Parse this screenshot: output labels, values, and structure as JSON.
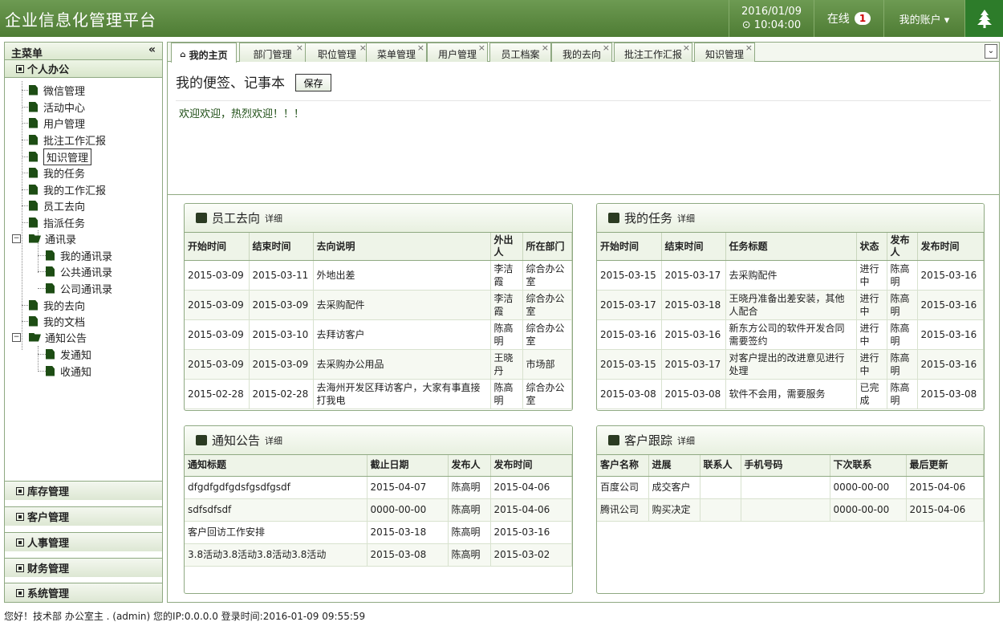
{
  "header": {
    "title": "企业信息化管理平台",
    "date": "2016/01/09",
    "time": "⊙ 10:04:00",
    "online_label": "在线",
    "online_count": "1",
    "account_label": "我的账户 ▾"
  },
  "sidebar": {
    "title": "主菜单",
    "collapse": "«",
    "group": "个人办公",
    "items": [
      "微信管理",
      "活动中心",
      "用户管理",
      "批注工作汇报",
      "知识管理",
      "我的任务",
      "我的工作汇报",
      "员工去向",
      "指派任务"
    ],
    "contacts": {
      "label": "通讯录",
      "children": [
        "我的通讯录",
        "公共通讯录",
        "公司通讯录"
      ]
    },
    "items2": [
      "我的去向",
      "我的文档"
    ],
    "notice": {
      "label": "通知公告",
      "children": [
        "发通知",
        "收通知"
      ]
    },
    "bottom": [
      "库存管理",
      "客户管理",
      "人事管理",
      "财务管理",
      "系统管理"
    ]
  },
  "tabs": [
    "我的主页",
    "部门管理",
    "职位管理",
    "菜单管理",
    "用户管理",
    "员工档案",
    "我的去向",
    "批注工作汇报",
    "知识管理"
  ],
  "notepad": {
    "title": "我的便签、记事本",
    "save": "保存",
    "text": "欢迎欢迎，热烈欢迎！！！"
  },
  "whereabouts": {
    "title": "员工去向",
    "more": "详细",
    "columns": [
      "开始时间",
      "结束时间",
      "去向说明",
      "外出人",
      "所在部门"
    ],
    "rows": [
      [
        "2015-03-09",
        "2015-03-11",
        "外地出差",
        "李洁霞",
        "综合办公室"
      ],
      [
        "2015-03-09",
        "2015-03-09",
        "去采购配件",
        "李洁霞",
        "综合办公室"
      ],
      [
        "2015-03-09",
        "2015-03-10",
        "去拜访客户",
        "陈高明",
        "综合办公室"
      ],
      [
        "2015-03-09",
        "2015-03-09",
        "去采购办公用品",
        "王晓丹",
        "市场部"
      ],
      [
        "2015-02-28",
        "2015-02-28",
        "去海州开发区拜访客户，大家有事直接打我电",
        "陈高明",
        "综合办公室"
      ]
    ]
  },
  "tasks": {
    "title": "我的任务",
    "more": "详细",
    "columns": [
      "开始时间",
      "结束时间",
      "任务标题",
      "状态",
      "发布人",
      "发布时间"
    ],
    "rows": [
      [
        "2015-03-15",
        "2015-03-17",
        "去采购配件",
        "进行中",
        "陈高明",
        "2015-03-16"
      ],
      [
        "2015-03-17",
        "2015-03-18",
        "王晓丹准备出差安装，其他人配合",
        "进行中",
        "陈高明",
        "2015-03-16"
      ],
      [
        "2015-03-16",
        "2015-03-16",
        "新东方公司的软件开发合同需要签约",
        "进行中",
        "陈高明",
        "2015-03-16"
      ],
      [
        "2015-03-15",
        "2015-03-17",
        "对客户提出的改进意见进行处理",
        "进行中",
        "陈高明",
        "2015-03-16"
      ],
      [
        "2015-03-08",
        "2015-03-08",
        "软件不会用，需要服务",
        "已完成",
        "陈高明",
        "2015-03-08"
      ]
    ]
  },
  "notices": {
    "title": "通知公告",
    "more": "详细",
    "columns": [
      "通知标题",
      "截止日期",
      "发布人",
      "发布时间"
    ],
    "rows": [
      [
        "dfgdfgdfgdsfgsdfgsdf",
        "2015-04-07",
        "陈高明",
        "2015-04-06"
      ],
      [
        "sdfsdfsdf",
        "0000-00-00",
        "陈高明",
        "2015-04-06"
      ],
      [
        "客户回访工作安排",
        "2015-03-18",
        "陈高明",
        "2015-03-16"
      ],
      [
        "3.8活动3.8活动3.8活动3.8活动",
        "2015-03-08",
        "陈高明",
        "2015-03-02"
      ]
    ]
  },
  "customers": {
    "title": "客户跟踪",
    "more": "详细",
    "columns": [
      "客户名称",
      "进展",
      "联系人",
      "手机号码",
      "下次联系",
      "最后更新"
    ],
    "rows": [
      [
        "百度公司",
        "成交客户",
        "",
        "",
        "0000-00-00",
        "2015-04-06"
      ],
      [
        "腾讯公司",
        "购买决定",
        "",
        "",
        "0000-00-00",
        "2015-04-06"
      ]
    ]
  },
  "status": "您好！技术部 办公室主                . (admin) 您的IP:0.0.0.0 登录时间:2016-01-09 09:55:59"
}
